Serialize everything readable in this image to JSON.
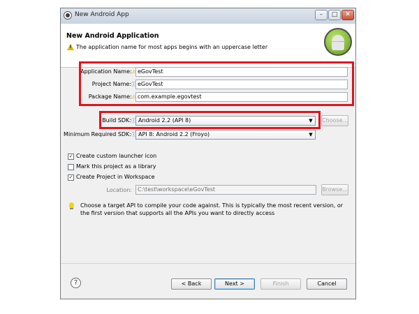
{
  "window": {
    "title": "New Android App"
  },
  "header": {
    "title": "New Android Application",
    "message": "The application name for most apps begins with an uppercase letter"
  },
  "form": {
    "application_name": {
      "label": "Application Name:",
      "value": "eGovTest"
    },
    "project_name": {
      "label": "Project Name:",
      "value": "eGovTest"
    },
    "package_name": {
      "label": "Package Name:",
      "value": "com.example.egovtest"
    },
    "build_sdk": {
      "label": "Build SDK:",
      "value": "Android 2.2 (API 8)",
      "choose_label": "Choose..."
    },
    "min_sdk": {
      "label": "Minimum Required SDK:",
      "value": "API 8: Android 2.2 (Froyo)"
    }
  },
  "options": [
    {
      "label": "Create custom launcher icon",
      "checked": true
    },
    {
      "label": "Mark this project as a library",
      "checked": false
    },
    {
      "label": "Create Project in Workspace",
      "checked": true
    }
  ],
  "location": {
    "label": "Location:",
    "value": "C:\\test\\workspace\\eGovTest",
    "browse_label": "Browse..."
  },
  "info_text": "Choose a target API to compile your code against. This is typically the most recent version, or the first version that supports all the APIs you want to directly access",
  "buttons": {
    "back": "< Back",
    "next": "Next >",
    "finish": "Finish",
    "cancel": "Cancel"
  },
  "colors": {
    "highlight": "#e0141e",
    "dialog_bg": "#f0f0f0"
  },
  "icons": [
    "app-icon",
    "minimize-icon",
    "maximize-icon",
    "close-icon",
    "warning-icon",
    "android-logo",
    "lightbulb-icon",
    "help-icon"
  ]
}
